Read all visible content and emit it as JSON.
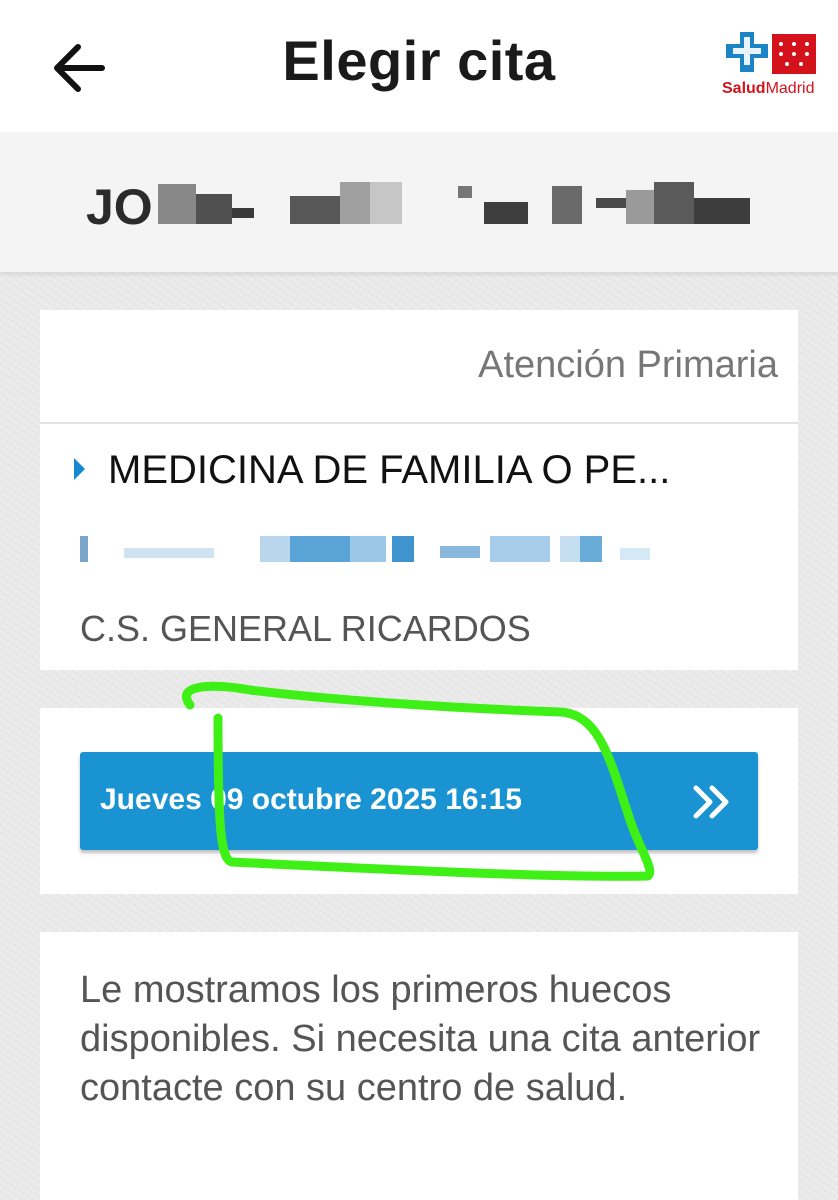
{
  "header": {
    "title": "Elegir cita",
    "back_icon": "arrow-left-icon",
    "logo": {
      "name": "salud-madrid-logo",
      "text_salud": "Salud",
      "text_madrid": "Madrid"
    }
  },
  "patient": {
    "name_visible": "JO"
  },
  "appointment_card": {
    "service_type": "Atención Primaria",
    "specialty": "MEDICINA DE FAMILIA O PE...",
    "center": "C.S. GENERAL RICARDOS"
  },
  "slot": {
    "label": "Jueves 09 octubre 2025 16:15",
    "icon": "double-chevron-right-icon"
  },
  "notice": {
    "text": "Le mostramos los primeros huecos disponibles. Si necesita una cita anterior contacte con su centro de salud."
  },
  "colors": {
    "accent": "#1a93d2",
    "logo_red": "#d4121c",
    "logo_blue": "#1b84c7",
    "annotation_green": "#3ff016"
  }
}
